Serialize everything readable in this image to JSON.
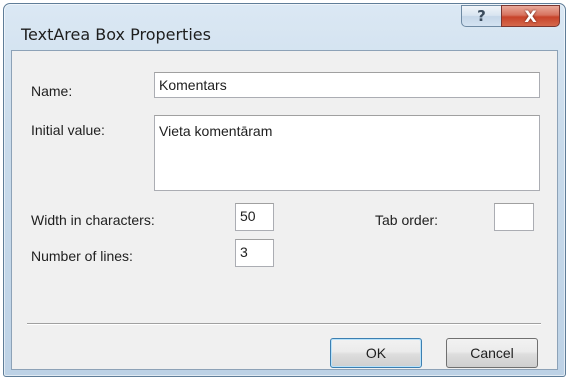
{
  "dialog": {
    "title": "TextArea Box Properties",
    "help_glyph": "?",
    "close_glyph": "X"
  },
  "form": {
    "name_label": "Name:",
    "name_value": "Komentars",
    "initial_value_label": "Initial value:",
    "initial_value": "Vieta komentāram",
    "width_label": "Width in characters:",
    "width_value": "50",
    "lines_label": "Number of lines:",
    "lines_value": "3",
    "tab_order_label": "Tab order:",
    "tab_order_value": ""
  },
  "buttons": {
    "ok_label": "OK",
    "cancel_label": "Cancel"
  }
}
